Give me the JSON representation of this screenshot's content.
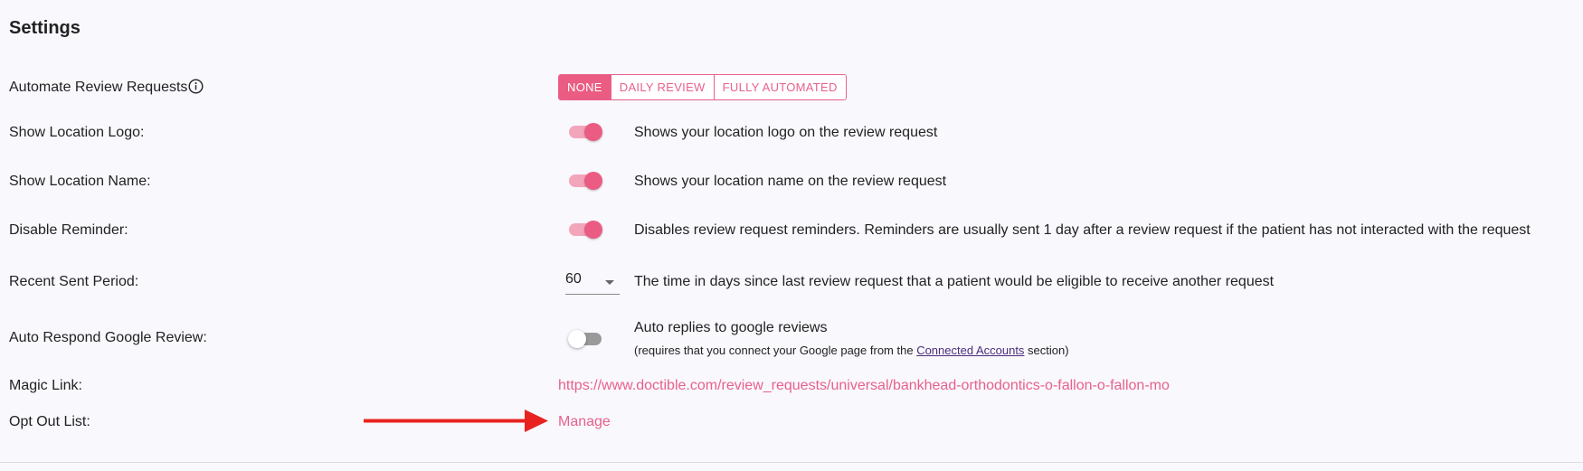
{
  "page": {
    "title": "Settings"
  },
  "automate": {
    "label": "Automate Review Requests",
    "info_icon": "info-circle-icon",
    "options": [
      "NONE",
      "DAILY REVIEW",
      "FULLY AUTOMATED"
    ],
    "selected": "NONE"
  },
  "show_logo": {
    "label": "Show Location Logo:",
    "enabled": true,
    "description": "Shows your location logo on the review request"
  },
  "show_name": {
    "label": "Show Location Name:",
    "enabled": true,
    "description": "Shows your location name on the review request"
  },
  "disable_reminder": {
    "label": "Disable Reminder:",
    "enabled": true,
    "description": "Disables review request reminders. Reminders are usually sent 1 day after a review request if the patient has not interacted with the request"
  },
  "recent_sent": {
    "label": "Recent Sent Period:",
    "value": "60",
    "description": "The time in days since last review request that a patient would be eligible to receive another request"
  },
  "auto_respond": {
    "label": "Auto Respond Google Review:",
    "enabled": false,
    "description": "Auto replies to google reviews",
    "sub_prefix": "(requires that you connect your Google page from the ",
    "sub_link": "Connected Accounts",
    "sub_suffix": " section)"
  },
  "magic_link": {
    "label": "Magic Link:",
    "url": "https://www.doctible.com/review_requests/universal/bankhead-orthodontics-o-fallon-o-fallon-mo"
  },
  "opt_out": {
    "label": "Opt Out List:",
    "link": "Manage"
  },
  "colors": {
    "accent": "#eb5c82",
    "accent_light": "#f3a5bb",
    "arrow": "#e8231f",
    "link_visited": "#4b2c7a"
  }
}
